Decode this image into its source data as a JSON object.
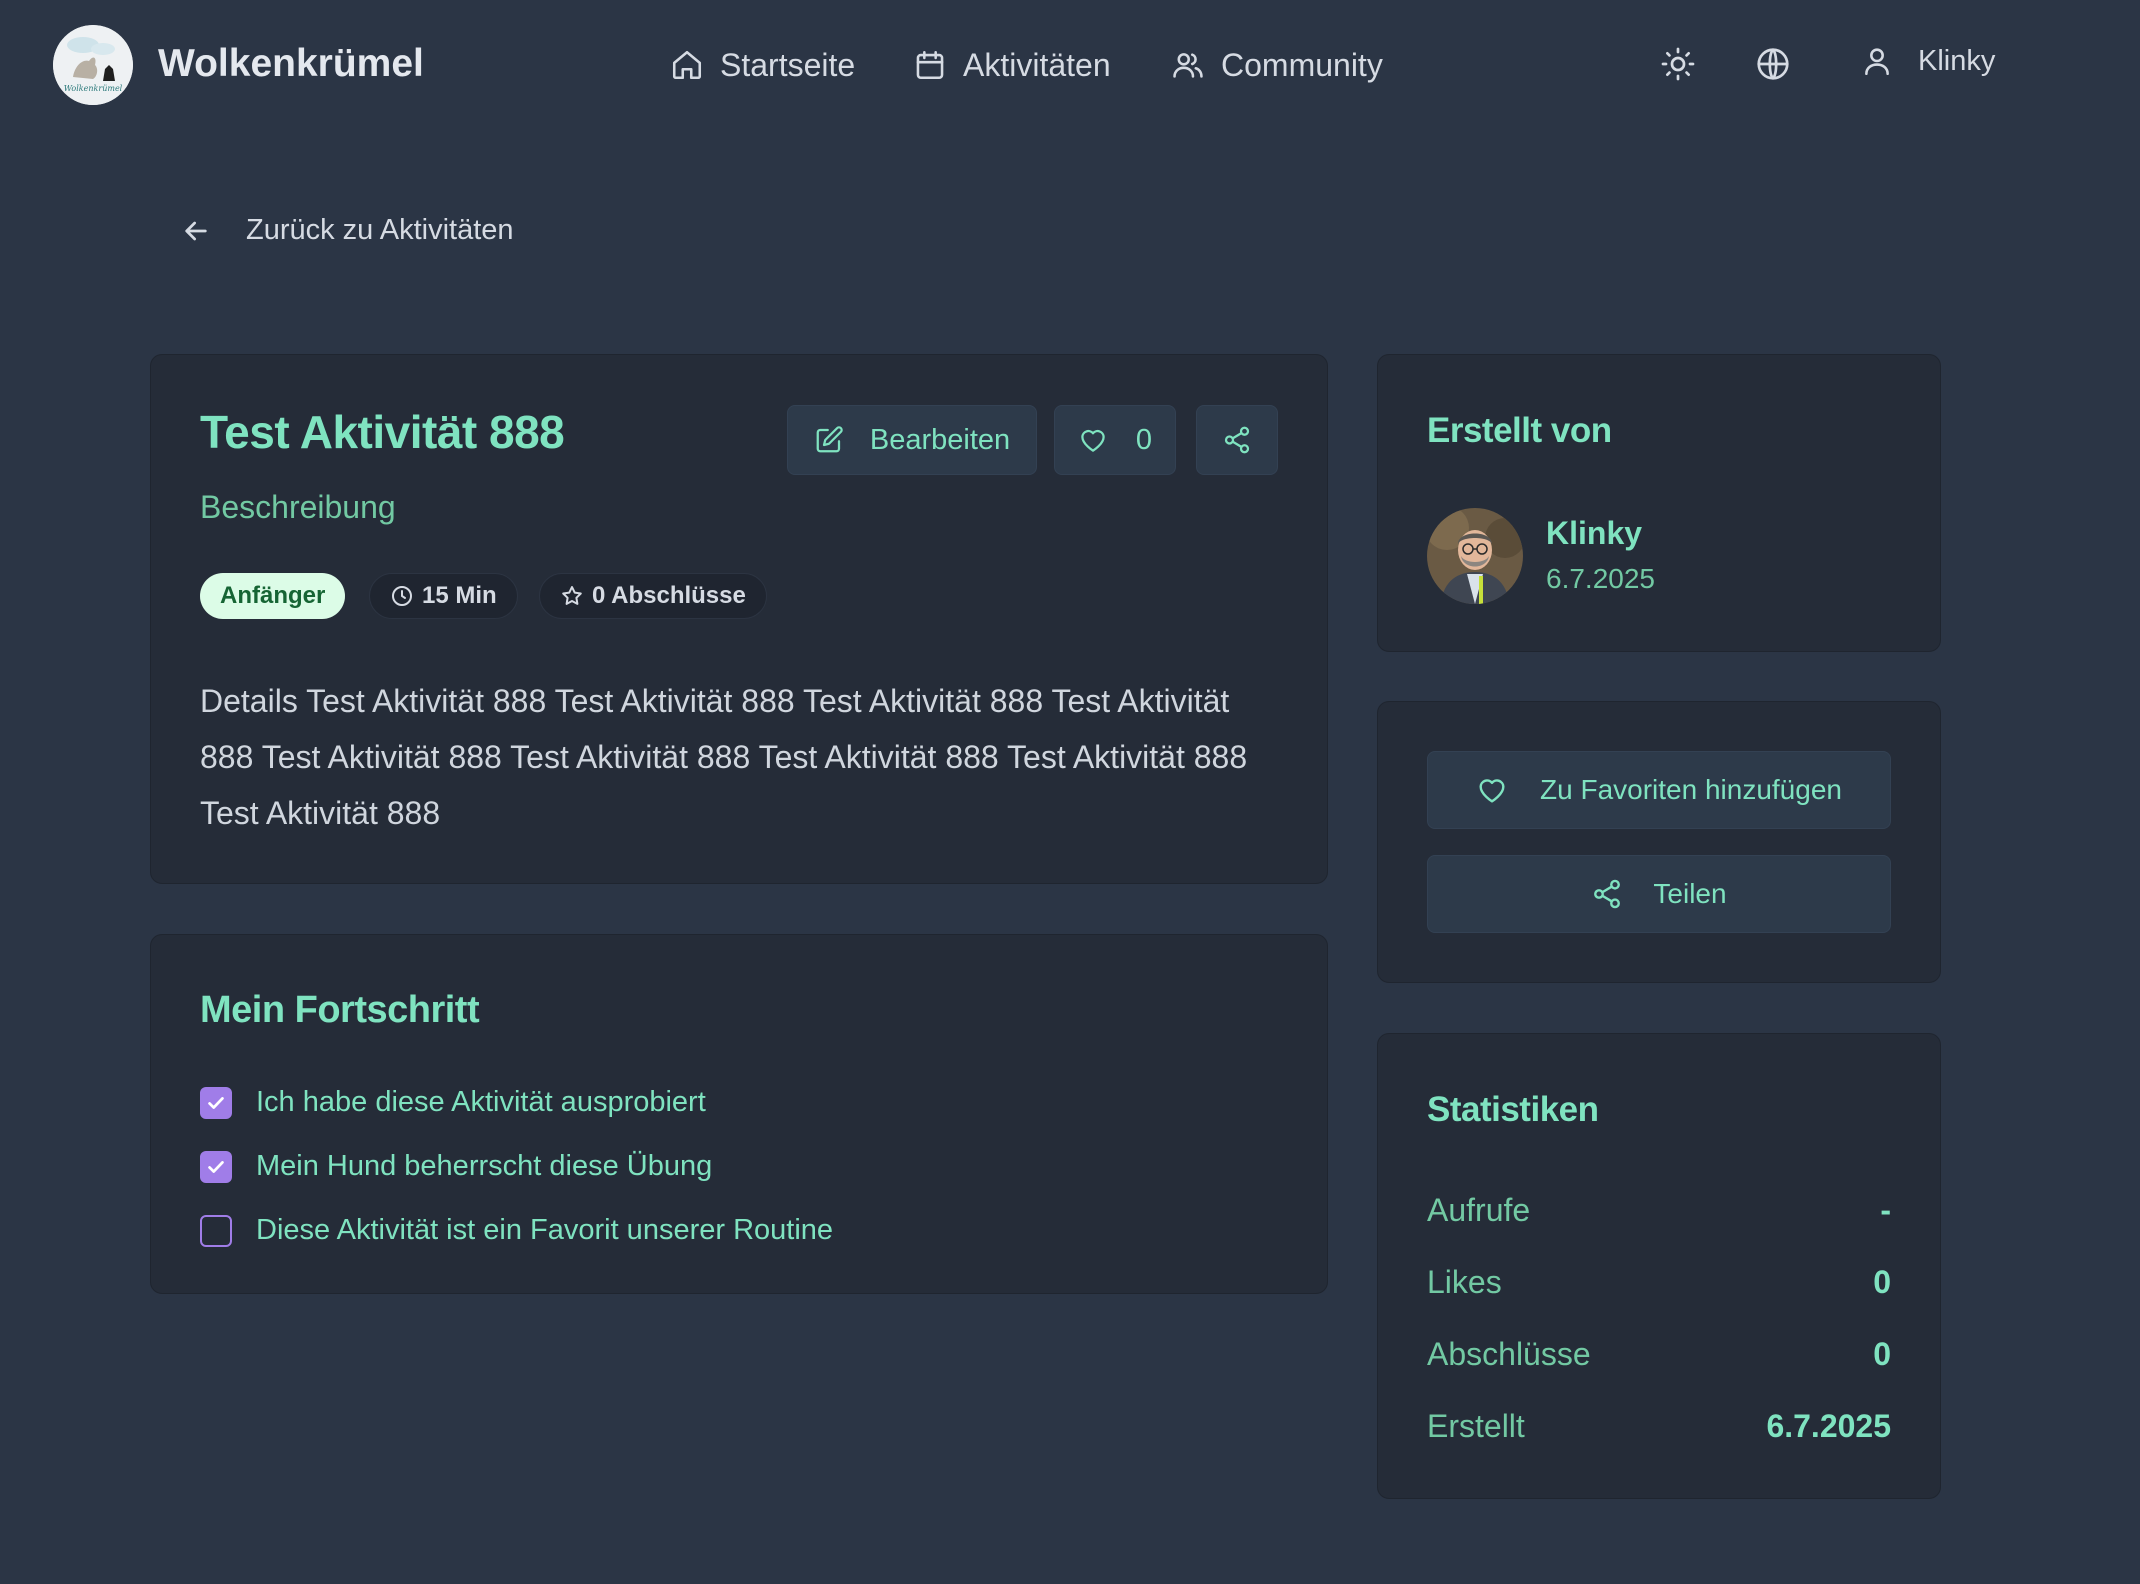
{
  "header": {
    "brand": "Wolkenkrümel",
    "logo_text": "Wolkenkrümel",
    "nav": [
      {
        "label": "Startseite",
        "icon": "home-icon"
      },
      {
        "label": "Aktivitäten",
        "icon": "calendar-icon"
      },
      {
        "label": "Community",
        "icon": "users-icon"
      }
    ],
    "theme_icon": "sun-icon",
    "language_icon": "globe-icon",
    "user": {
      "name": "Klinky",
      "icon": "user-icon"
    }
  },
  "back_link": {
    "label": "Zurück zu Aktivitäten",
    "icon": "arrow-left-icon"
  },
  "activity": {
    "title": "Test Aktivität 888",
    "subtitle": "Beschreibung",
    "edit_label": "Bearbeiten",
    "like_count": "0",
    "badges": {
      "level": "Anfänger",
      "duration": "15 Min",
      "completions": "0 Abschlüsse"
    },
    "details": "Details Test Aktivität  888 Test Aktivität  888 Test Aktivität  888 Test Aktivität  888 Test Aktivität  888 Test Aktivität  888 Test Aktivität  888 Test Aktivität  888 Test Aktivität  888"
  },
  "progress": {
    "title": "Mein Fortschritt",
    "items": [
      {
        "label": "Ich habe diese Aktivität ausprobiert",
        "checked": true
      },
      {
        "label": "Mein Hund beherrscht diese Übung",
        "checked": true
      },
      {
        "label": "Diese Aktivität ist ein Favorit unserer Routine",
        "checked": false
      }
    ]
  },
  "author": {
    "title": "Erstellt von",
    "name": "Klinky",
    "date": "6.7.2025"
  },
  "actions": {
    "favorite_label": "Zu Favoriten hinzufügen",
    "share_label": "Teilen"
  },
  "stats": {
    "title": "Statistiken",
    "rows": [
      {
        "label": "Aufrufe",
        "value": "-"
      },
      {
        "label": "Likes",
        "value": "0"
      },
      {
        "label": "Abschlüsse",
        "value": "0"
      },
      {
        "label": "Erstellt",
        "value": "6.7.2025"
      }
    ]
  },
  "colors": {
    "background": "#2b3545",
    "card": "#252c38",
    "accent": "#7fe3c0",
    "checkbox": "#a07de8"
  }
}
